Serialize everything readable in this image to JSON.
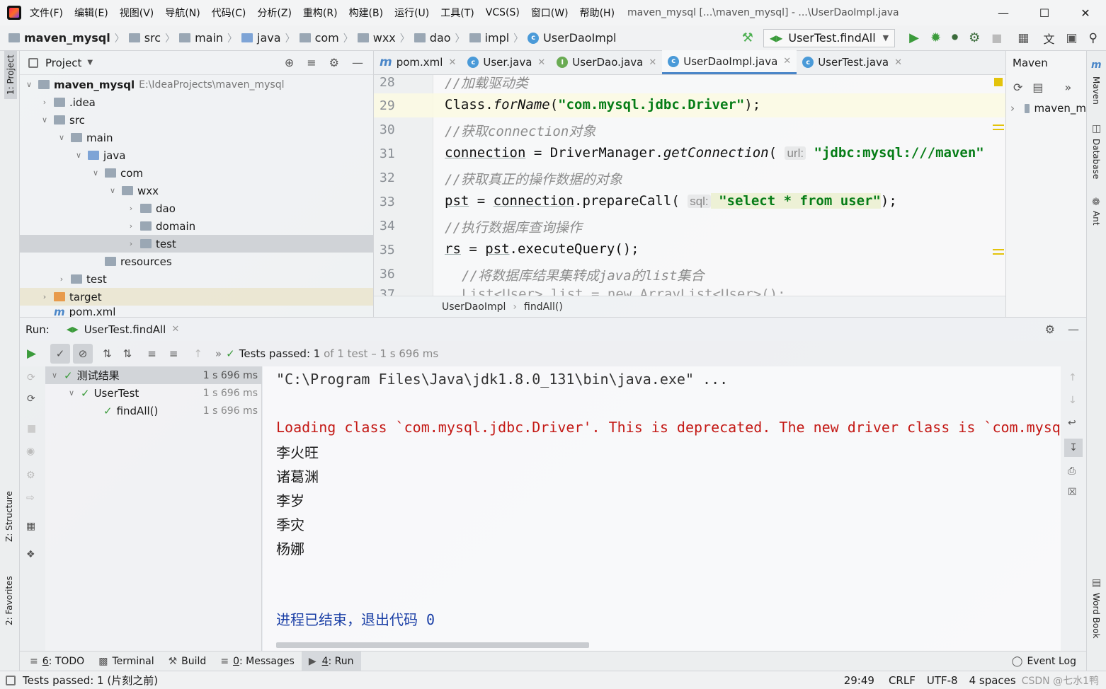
{
  "window": {
    "title": "maven_mysql [...\\maven_mysql] - ...\\UserDaoImpl.java",
    "menu": [
      "文件(F)",
      "编辑(E)",
      "视图(V)",
      "导航(N)",
      "代码(C)",
      "分析(Z)",
      "重构(R)",
      "构建(B)",
      "运行(U)",
      "工具(T)",
      "VCS(S)",
      "窗口(W)",
      "帮助(H)"
    ]
  },
  "navbar": {
    "crumbs": [
      "maven_mysql",
      "src",
      "main",
      "java",
      "com",
      "wxx",
      "dao",
      "impl",
      "UserDaoImpl"
    ],
    "run_config": "UserTest.findAll"
  },
  "left_strip": {
    "project": "1: Project",
    "structure": "Z: Structure",
    "favorites": "2: Favorites"
  },
  "project": {
    "header": "Project",
    "root_name": "maven_mysql",
    "root_path": "E:\\IdeaProjects\\maven_mysql",
    "items": [
      ".idea",
      "src",
      "main",
      "java",
      "com",
      "wxx",
      "dao",
      "domain",
      "test",
      "resources",
      "test",
      "target",
      "pom.xml"
    ]
  },
  "tabs": [
    "pom.xml",
    "User.java",
    "UserDao.java",
    "UserDaoImpl.java",
    "UserTest.java"
  ],
  "editor": {
    "lines": [
      "28",
      "29",
      "30",
      "31",
      "32",
      "33",
      "34",
      "35",
      "36",
      "37"
    ],
    "c28": "//加载驱动类",
    "c29a": "Class.",
    "c29b": "forName",
    "c29c": "(",
    "c29d": "\"com.mysql.jdbc.Driver\"",
    "c29e": ");",
    "c30": "//获取connection对象",
    "c31a": "connection",
    "c31b": " = DriverManager.",
    "c31c": "getConnection",
    "c31d": "( ",
    "c31hint": "url:",
    "c31e": " \"jdbc:mysql:///maven\"",
    "c32": "//获取真正的操作数据的对象",
    "c33a": "pst",
    "c33b": " = ",
    "c33c": "connection",
    "c33d": ".prepareCall( ",
    "c33hint": "sql:",
    "c33e": " \"select * from user\"",
    "c33f": ");",
    "c34": "//执行数据库查询操作",
    "c35a": "rs",
    "c35b": " = ",
    "c35c": "pst",
    "c35d": ".executeQuery();",
    "c36": "//将数据库结果集转成java的list集合",
    "c37": "List<User> list = new ArrayList<User>();"
  },
  "editor_crumbs": [
    "UserDaoImpl",
    "findAll()"
  ],
  "maven": {
    "title": "Maven",
    "item": "maven_m"
  },
  "right_strip": {
    "maven": "Maven",
    "database": "Database",
    "ant": "Ant",
    "wordbook": "Word Book"
  },
  "run": {
    "label": "Run:",
    "tab": "UserTest.findAll",
    "status_prefix": "Tests passed: ",
    "status_count": "1",
    "status_suffix": " of 1 test – 1 s 696 ms",
    "tree": [
      {
        "label": "测试结果",
        "time": "1 s 696 ms"
      },
      {
        "label": "UserTest",
        "time": "1 s 696 ms"
      },
      {
        "label": "findAll()",
        "time": "1 s 696 ms"
      }
    ],
    "console": {
      "cmd": "\"C:\\Program Files\\Java\\jdk1.8.0_131\\bin\\java.exe\" ...",
      "warning": "Loading class `com.mysql.jdbc.Driver'. This is deprecated. The new driver class is `com.mysql",
      "names": [
        "李火旺",
        "诸葛渊",
        "李岁",
        "季灾",
        "杨娜"
      ],
      "exit": "进程已结束，退出代码 0"
    }
  },
  "tool_tabs": [
    {
      "key": "6",
      "label": ": TODO"
    },
    {
      "key": "",
      "label": "Terminal"
    },
    {
      "key": "",
      "label": "Build"
    },
    {
      "key": "0",
      "label": ": Messages"
    },
    {
      "key": "4",
      "label": ": Run"
    }
  ],
  "event_log": "Event Log",
  "status": {
    "message": "Tests passed: 1 (片刻之前)",
    "position": "29:49",
    "line_sep": "CRLF",
    "encoding": "UTF-8",
    "indent": "4 spaces",
    "watermark": "CSDN @七水1鸭"
  },
  "colors": {
    "accent": "#4a86c8",
    "pass": "#3b9b3b",
    "string": "#067d17",
    "error": "#c41a16",
    "console_blue": "#1a3fa6"
  }
}
